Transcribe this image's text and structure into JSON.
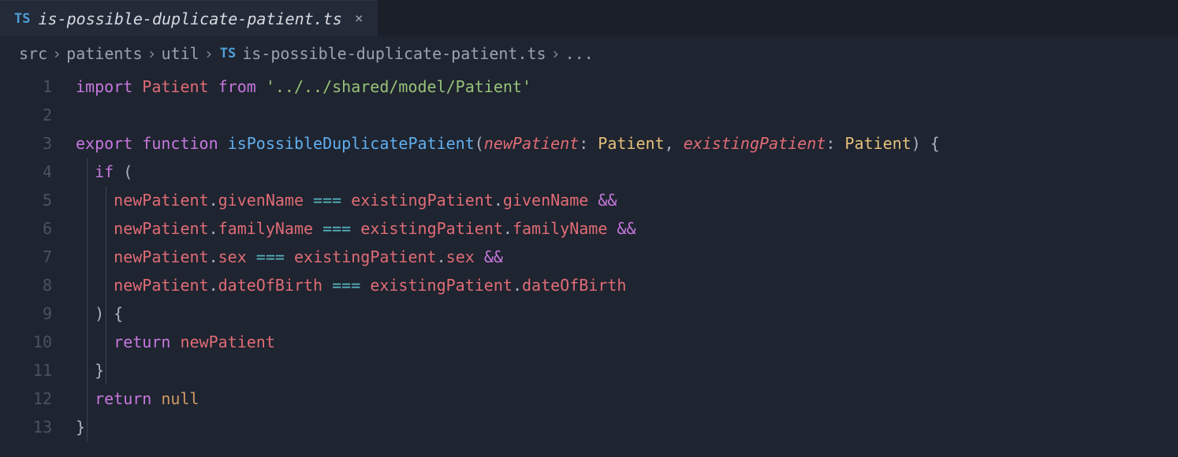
{
  "tab": {
    "icon_label": "TS",
    "filename": "is-possible-duplicate-patient.ts",
    "close_symbol": "×"
  },
  "breadcrumbs": {
    "separator": "›",
    "items": [
      "src",
      "patients",
      "util"
    ],
    "file_icon": "TS",
    "file": "is-possible-duplicate-patient.ts",
    "tail": "..."
  },
  "code": {
    "lines": [
      [
        {
          "t": "import ",
          "c": "kw-import"
        },
        {
          "t": "Patient",
          "c": "ident"
        },
        {
          "t": " from ",
          "c": "kw-from"
        },
        {
          "t": "'../../shared/model/Patient'",
          "c": "str"
        }
      ],
      [],
      [
        {
          "t": "export ",
          "c": "kw-export"
        },
        {
          "t": "function ",
          "c": "kw-function"
        },
        {
          "t": "isPossibleDuplicatePatient",
          "c": "fn-name"
        },
        {
          "t": "(",
          "c": "punct"
        },
        {
          "t": "newPatient",
          "c": "param"
        },
        {
          "t": ":",
          "c": "colon"
        },
        {
          "t": " Patient",
          "c": "type"
        },
        {
          "t": ", ",
          "c": "punct"
        },
        {
          "t": "existingPatient",
          "c": "param"
        },
        {
          "t": ":",
          "c": "colon"
        },
        {
          "t": " Patient",
          "c": "type"
        },
        {
          "t": ") {",
          "c": "punct"
        }
      ],
      [
        {
          "t": "  ",
          "c": "plain"
        },
        {
          "t": "if ",
          "c": "kw-if"
        },
        {
          "t": "(",
          "c": "punct"
        }
      ],
      [
        {
          "t": "    ",
          "c": "plain"
        },
        {
          "t": "newPatient",
          "c": "obj"
        },
        {
          "t": ".",
          "c": "punct"
        },
        {
          "t": "givenName",
          "c": "prop"
        },
        {
          "t": " === ",
          "c": "op"
        },
        {
          "t": "existingPatient",
          "c": "obj"
        },
        {
          "t": ".",
          "c": "punct"
        },
        {
          "t": "givenName",
          "c": "prop"
        },
        {
          "t": " &&",
          "c": "logop"
        }
      ],
      [
        {
          "t": "    ",
          "c": "plain"
        },
        {
          "t": "newPatient",
          "c": "obj"
        },
        {
          "t": ".",
          "c": "punct"
        },
        {
          "t": "familyName",
          "c": "prop"
        },
        {
          "t": " === ",
          "c": "op"
        },
        {
          "t": "existingPatient",
          "c": "obj"
        },
        {
          "t": ".",
          "c": "punct"
        },
        {
          "t": "familyName",
          "c": "prop"
        },
        {
          "t": " &&",
          "c": "logop"
        }
      ],
      [
        {
          "t": "    ",
          "c": "plain"
        },
        {
          "t": "newPatient",
          "c": "obj"
        },
        {
          "t": ".",
          "c": "punct"
        },
        {
          "t": "sex",
          "c": "prop"
        },
        {
          "t": " === ",
          "c": "op"
        },
        {
          "t": "existingPatient",
          "c": "obj"
        },
        {
          "t": ".",
          "c": "punct"
        },
        {
          "t": "sex",
          "c": "prop"
        },
        {
          "t": " &&",
          "c": "logop"
        }
      ],
      [
        {
          "t": "    ",
          "c": "plain"
        },
        {
          "t": "newPatient",
          "c": "obj"
        },
        {
          "t": ".",
          "c": "punct"
        },
        {
          "t": "dateOfBirth",
          "c": "prop"
        },
        {
          "t": " === ",
          "c": "op"
        },
        {
          "t": "existingPatient",
          "c": "obj"
        },
        {
          "t": ".",
          "c": "punct"
        },
        {
          "t": "dateOfBirth",
          "c": "prop"
        }
      ],
      [
        {
          "t": "  ) {",
          "c": "punct"
        }
      ],
      [
        {
          "t": "    ",
          "c": "plain"
        },
        {
          "t": "return ",
          "c": "kw-return"
        },
        {
          "t": "newPatient",
          "c": "obj"
        }
      ],
      [
        {
          "t": "  }",
          "c": "punct"
        }
      ],
      [
        {
          "t": "  ",
          "c": "plain"
        },
        {
          "t": "return ",
          "c": "kw-return"
        },
        {
          "t": "null",
          "c": "kw-null"
        }
      ],
      [
        {
          "t": "}",
          "c": "punct"
        }
      ]
    ],
    "indent_guides": [
      {
        "col": 1,
        "from": 4,
        "to": 13
      },
      {
        "col": 2,
        "from": 5,
        "to": 11
      }
    ]
  }
}
